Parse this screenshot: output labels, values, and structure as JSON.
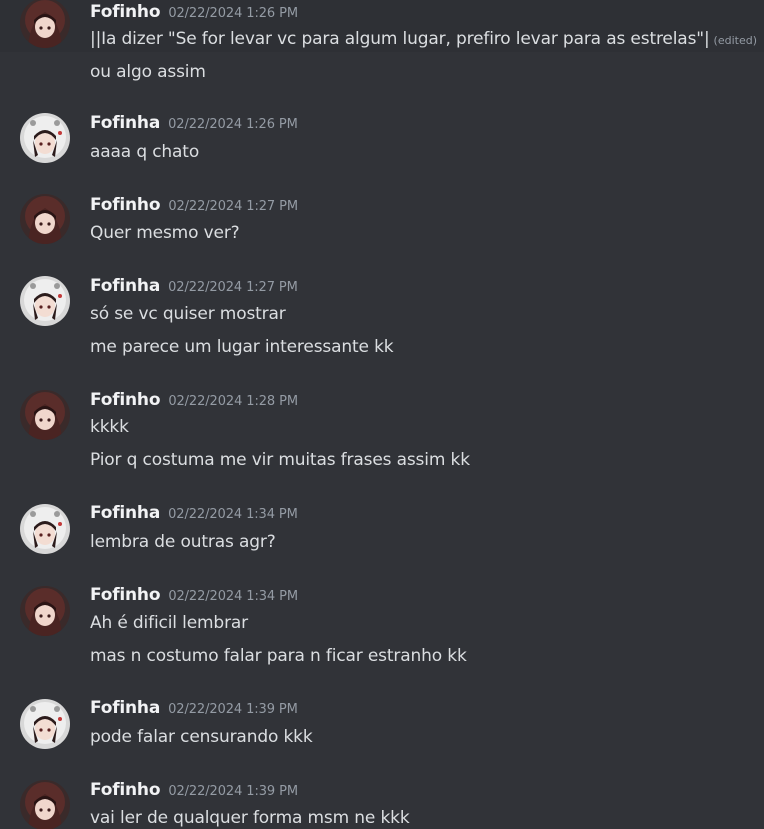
{
  "colors": {
    "background": "#313338",
    "author": "#f2f3f5",
    "timestamp": "#949ba4",
    "text": "#dbdee1"
  },
  "messages": [
    {
      "author": "Fofinho",
      "avatar": "reddish-hood-avatar-icon",
      "timestamp": "02/22/2024 1:26 PM",
      "lines": [
        "||Ia dizer \"Se for levar vc para algum lugar, prefiro levar para as estrelas\"|",
        "ou algo assim"
      ],
      "edited_label": "(edited)"
    },
    {
      "author": "Fofinha",
      "avatar": "white-hood-avatar-icon",
      "timestamp": "02/22/2024 1:26 PM",
      "lines": [
        "aaaa q chato"
      ]
    },
    {
      "author": "Fofinho",
      "avatar": "reddish-hood-avatar-icon",
      "timestamp": "02/22/2024 1:27 PM",
      "lines": [
        "Quer mesmo ver?"
      ]
    },
    {
      "author": "Fofinha",
      "avatar": "white-hood-avatar-icon",
      "timestamp": "02/22/2024 1:27 PM",
      "lines": [
        "só se vc quiser mostrar",
        "me parece um lugar interessante kk"
      ]
    },
    {
      "author": "Fofinho",
      "avatar": "reddish-hood-avatar-icon",
      "timestamp": "02/22/2024 1:28 PM",
      "lines": [
        "kkkk",
        "Pior q costuma me vir muitas frases assim kk"
      ]
    },
    {
      "author": "Fofinha",
      "avatar": "white-hood-avatar-icon",
      "timestamp": "02/22/2024 1:34 PM",
      "lines": [
        "lembra de outras agr?"
      ]
    },
    {
      "author": "Fofinho",
      "avatar": "reddish-hood-avatar-icon",
      "timestamp": "02/22/2024 1:34 PM",
      "lines": [
        "Ah é dificil lembrar",
        "mas n costumo falar para n ficar estranho kk"
      ]
    },
    {
      "author": "Fofinha",
      "avatar": "white-hood-avatar-icon",
      "timestamp": "02/22/2024 1:39 PM",
      "lines": [
        "pode falar censurando kkk"
      ]
    },
    {
      "author": "Fofinho",
      "avatar": "reddish-hood-avatar-icon",
      "timestamp": "02/22/2024 1:39 PM",
      "lines": [
        "vai ler de qualquer forma msm ne kkk"
      ]
    }
  ]
}
